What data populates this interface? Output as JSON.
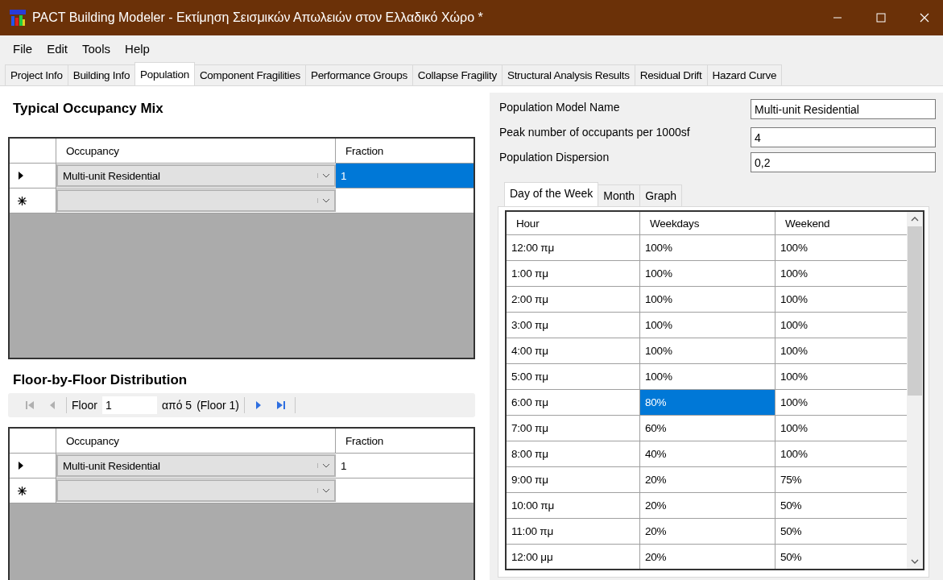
{
  "window": {
    "title": "PACT Building Modeler - Εκτίμηση Σεισμικών Απωλειών στον Ελλαδικό Χώρο *"
  },
  "menu": [
    "File",
    "Edit",
    "Tools",
    "Help"
  ],
  "tabs": [
    {
      "label": "Project Info",
      "selected": false
    },
    {
      "label": "Building Info",
      "selected": false
    },
    {
      "label": "Population",
      "selected": true
    },
    {
      "label": "Component Fragilities",
      "selected": false
    },
    {
      "label": "Performance Groups",
      "selected": false
    },
    {
      "label": "Collapse Fragility",
      "selected": false
    },
    {
      "label": "Structural Analysis Results",
      "selected": false
    },
    {
      "label": "Residual Drift",
      "selected": false
    },
    {
      "label": "Hazard Curve",
      "selected": false
    }
  ],
  "occupancy_mix": {
    "title": "Typical Occupancy Mix",
    "columns": [
      "Occupancy",
      "Fraction"
    ],
    "rows": [
      {
        "kind": "current",
        "occupancy": "Multi-unit Residential",
        "fraction": "1",
        "selected": true
      },
      {
        "kind": "new",
        "occupancy": "",
        "fraction": "",
        "selected": false
      }
    ]
  },
  "floor_distribution": {
    "title": "Floor-by-Floor Distribution",
    "navigator": {
      "label": "Floor",
      "value": "1",
      "count": "από 5",
      "current": "(Floor 1)",
      "first_disabled": true,
      "last_disabled": false
    },
    "columns": [
      "Occupancy",
      "Fraction"
    ],
    "rows": [
      {
        "kind": "current",
        "occupancy": "Multi-unit Residential",
        "fraction": "1",
        "selected": false
      },
      {
        "kind": "new",
        "occupancy": "",
        "fraction": "",
        "selected": false
      }
    ]
  },
  "fields": [
    {
      "label": "Population Model Name",
      "value": "Multi-unit Residential"
    },
    {
      "label": "Peak number of occupants per 1000sf",
      "value": "4"
    },
    {
      "label": "Population Dispersion",
      "value": "0,2"
    }
  ],
  "sub_tabs": [
    {
      "label": "Day of the Week",
      "selected": true
    },
    {
      "label": "Month",
      "selected": false
    },
    {
      "label": "Graph",
      "selected": false
    }
  ],
  "schedule": {
    "columns": [
      "Hour",
      "Weekdays",
      "Weekend"
    ],
    "rows": [
      {
        "hour": "12:00 πμ",
        "weekdays": "100%",
        "weekend": "100%",
        "selected": false
      },
      {
        "hour": "1:00 πμ",
        "weekdays": "100%",
        "weekend": "100%",
        "selected": false
      },
      {
        "hour": "2:00 πμ",
        "weekdays": "100%",
        "weekend": "100%",
        "selected": false
      },
      {
        "hour": "3:00 πμ",
        "weekdays": "100%",
        "weekend": "100%",
        "selected": false
      },
      {
        "hour": "4:00 πμ",
        "weekdays": "100%",
        "weekend": "100%",
        "selected": false
      },
      {
        "hour": "5:00 πμ",
        "weekdays": "100%",
        "weekend": "100%",
        "selected": false
      },
      {
        "hour": "6:00 πμ",
        "weekdays": "80%",
        "weekend": "100%",
        "selected": true
      },
      {
        "hour": "7:00 πμ",
        "weekdays": "60%",
        "weekend": "100%",
        "selected": false
      },
      {
        "hour": "8:00 πμ",
        "weekdays": "40%",
        "weekend": "100%",
        "selected": false
      },
      {
        "hour": "9:00 πμ",
        "weekdays": "20%",
        "weekend": "75%",
        "selected": false
      },
      {
        "hour": "10:00 πμ",
        "weekdays": "20%",
        "weekend": "50%",
        "selected": false
      },
      {
        "hour": "11:00 πμ",
        "weekdays": "20%",
        "weekend": "50%",
        "selected": false
      },
      {
        "hour": "12:00 μμ",
        "weekdays": "20%",
        "weekend": "50%",
        "selected": false
      }
    ]
  }
}
